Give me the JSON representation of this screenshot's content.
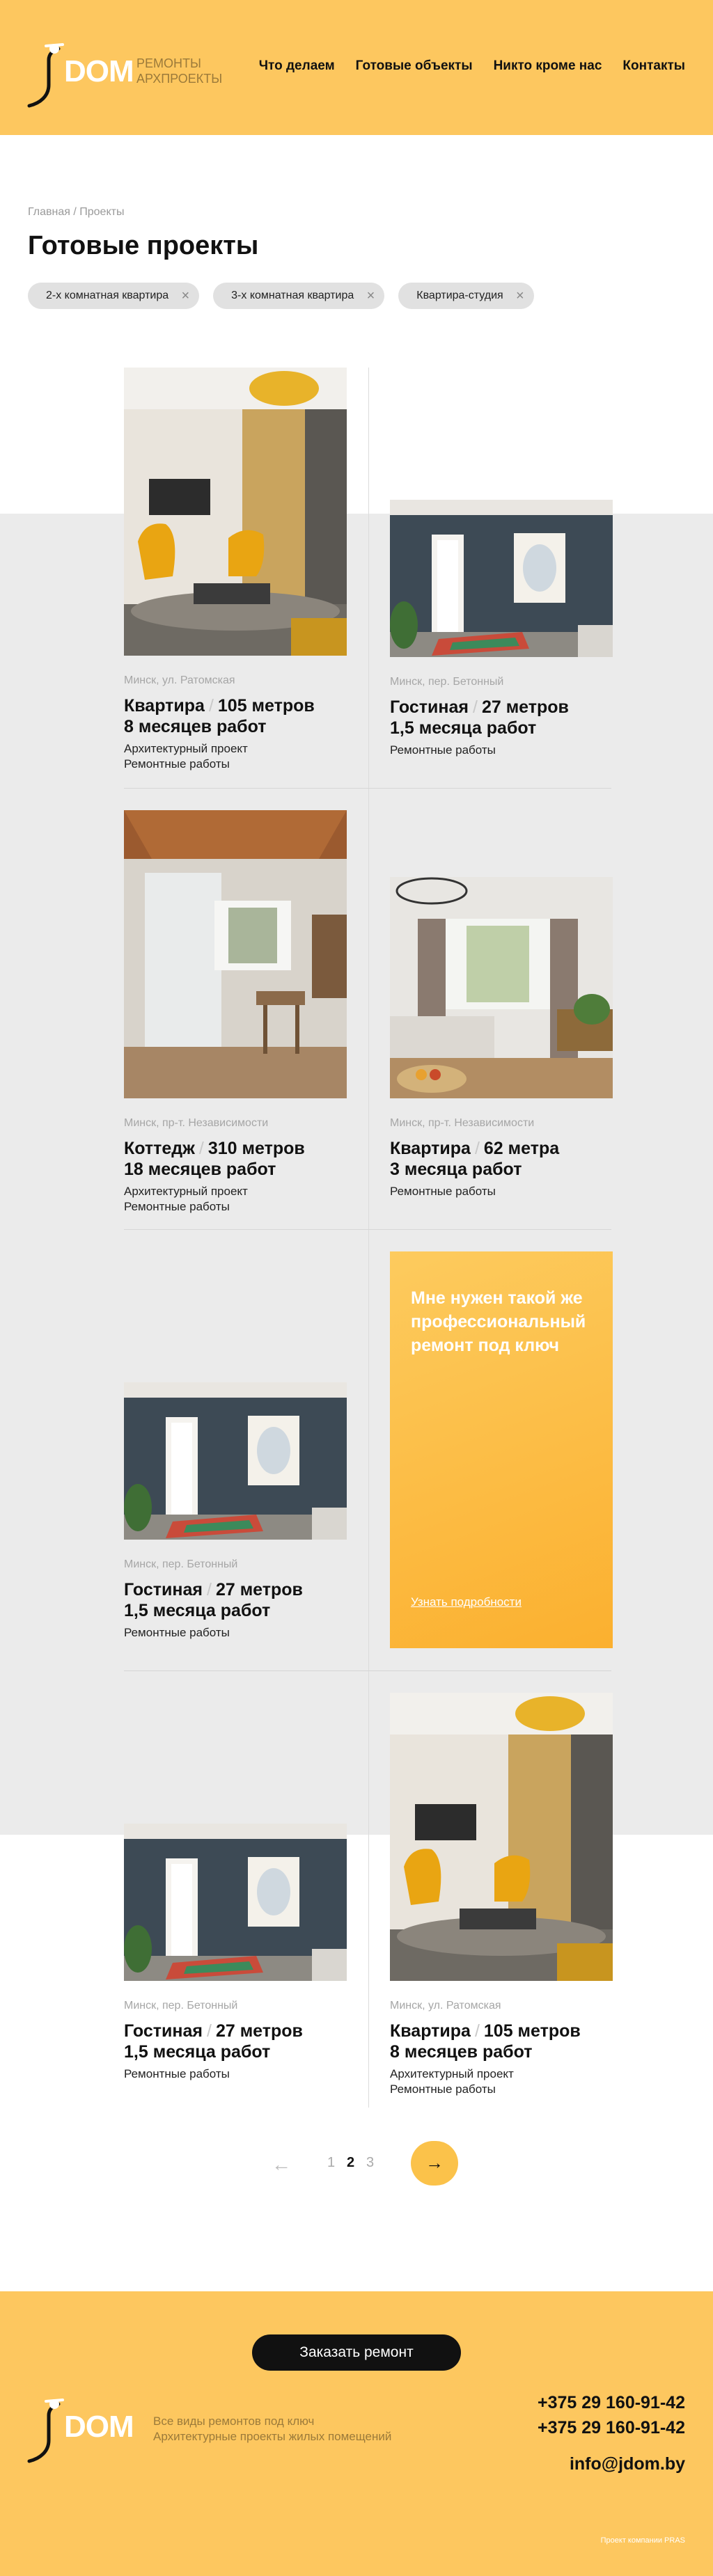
{
  "header": {
    "logo_text": "DOM",
    "logo_tagline": [
      "РЕМОНТЫ",
      "АРХПРОЕКТЫ"
    ],
    "nav": [
      "Что делаем",
      "Готовые объекты",
      "Никто кроме нас",
      "Контакты"
    ]
  },
  "breadcrumb": {
    "home": "Главная",
    "separator": " / ",
    "current": "Проекты"
  },
  "page_title": "Готовые проекты",
  "filters": [
    "2-х комнатная квартира",
    "3-х комнатная квартира",
    "Квартира-студия"
  ],
  "cards": [
    {
      "location": "Минск, ул. Ратомская",
      "type": "Квартира",
      "area": "105 метров",
      "duration": "8 месяцев работ",
      "works": [
        "Архитектурный проект",
        "Ремонтные работы"
      ],
      "photo": "yellow-chair-living-room"
    },
    {
      "location": "Минск, пер. Бетонный",
      "type": "Гостиная",
      "area": "27 метров",
      "duration": "1,5 месяца работ",
      "works": [
        "Ремонтные работы"
      ],
      "photo": "dark-blue-room-cat-poster"
    },
    {
      "location": "Минск, пр-т. Независимости",
      "type": "Коттедж",
      "area": "310 метров",
      "duration": "18 месяцев работ",
      "works": [
        "Архитектурный проект",
        "Ремонтные работы"
      ],
      "photo": "bathroom-wood-ceiling"
    },
    {
      "location": "Минск, пр-т. Независимости",
      "type": "Квартира",
      "area": "62 метра",
      "duration": "3 месяца работ",
      "works": [
        "Ремонтные работы"
      ],
      "photo": "living-room-chandelier"
    },
    {
      "location": "Минск, пер. Бетонный",
      "type": "Гостиная",
      "area": "27 метров",
      "duration": "1,5 месяца работ",
      "works": [
        "Ремонтные работы"
      ],
      "photo": "dark-blue-room-cat-poster"
    },
    {
      "location": "Минск, пер. Бетонный",
      "type": "Гостиная",
      "area": "27 метров",
      "duration": "1,5 месяца работ",
      "works": [
        "Ремонтные работы"
      ],
      "photo": "dark-blue-room-cat-poster"
    },
    {
      "location": "Минск, ул. Ратомская",
      "type": "Квартира",
      "area": "105 метров",
      "duration": "8 месяцев работ",
      "works": [
        "Архитектурный проект",
        "Ремонтные работы"
      ],
      "photo": "yellow-chair-living-room"
    }
  ],
  "promo": {
    "text": "Мне нужен такой же профессиональный ремонт под ключ",
    "link": "Узнать подробности"
  },
  "pagination": {
    "prev_icon": "arrow-left-icon",
    "pages": [
      "1",
      "2",
      "3"
    ],
    "current": "2",
    "next_icon": "arrow-right-icon"
  },
  "footer": {
    "order_button": "Заказать ремонт",
    "tagline": [
      "Все виды ремонтов под ключ",
      "Архитектурные проекты жилых помещений"
    ],
    "phones": [
      "+375 29 160-91-42",
      "+375 29 160-91-42"
    ],
    "email": "info@jdom.by",
    "credit": "Проект компании PRAS"
  },
  "colors": {
    "accent": "#fdc75f",
    "promo_start": "#fdcb5e",
    "promo_end": "#fbb02f",
    "gray_band": "#ebebeb",
    "text": "#111111"
  }
}
